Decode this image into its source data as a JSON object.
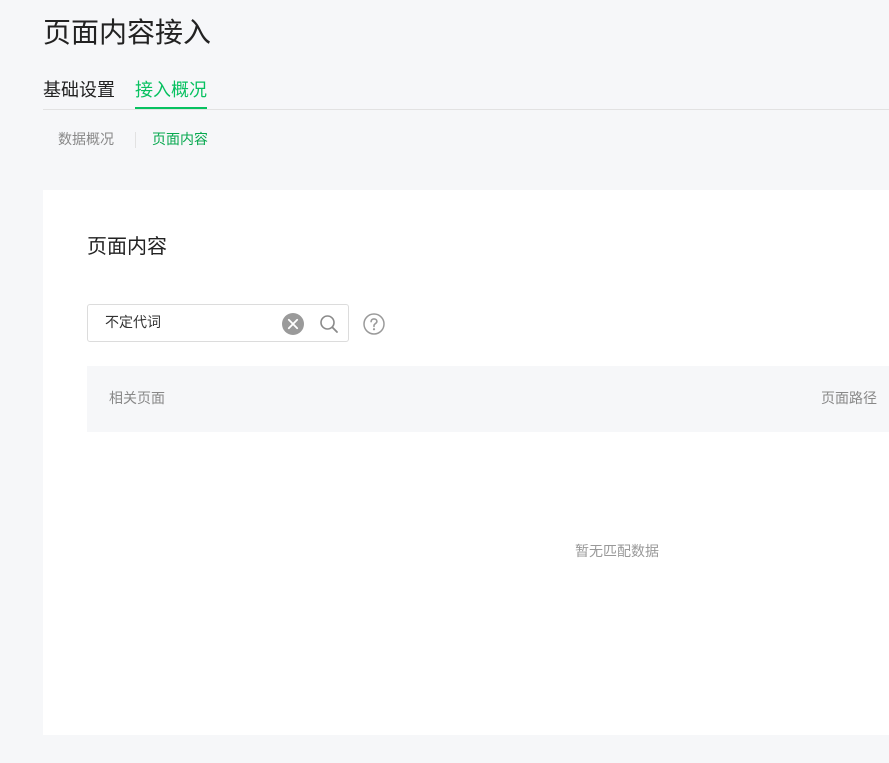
{
  "page": {
    "title": "页面内容接入"
  },
  "main_tabs": [
    {
      "label": "基础设置",
      "active": false
    },
    {
      "label": "接入概况",
      "active": true
    }
  ],
  "sub_tabs": [
    {
      "label": "数据概况",
      "active": false
    },
    {
      "label": "页面内容",
      "active": true
    }
  ],
  "card": {
    "title": "页面内容",
    "search": {
      "value": "不定代词",
      "placeholder": ""
    },
    "table": {
      "columns": [
        "相关页面",
        "页面路径"
      ],
      "rows": [],
      "empty_text": "暂无匹配数据"
    }
  },
  "icons": {
    "clear": "clear-circle-icon",
    "search": "search-icon",
    "help": "help-circle-icon"
  },
  "colors": {
    "accent": "#07c160",
    "sub_accent": "#07a84f",
    "page_bg": "#f6f7f9",
    "card_bg": "#ffffff"
  }
}
